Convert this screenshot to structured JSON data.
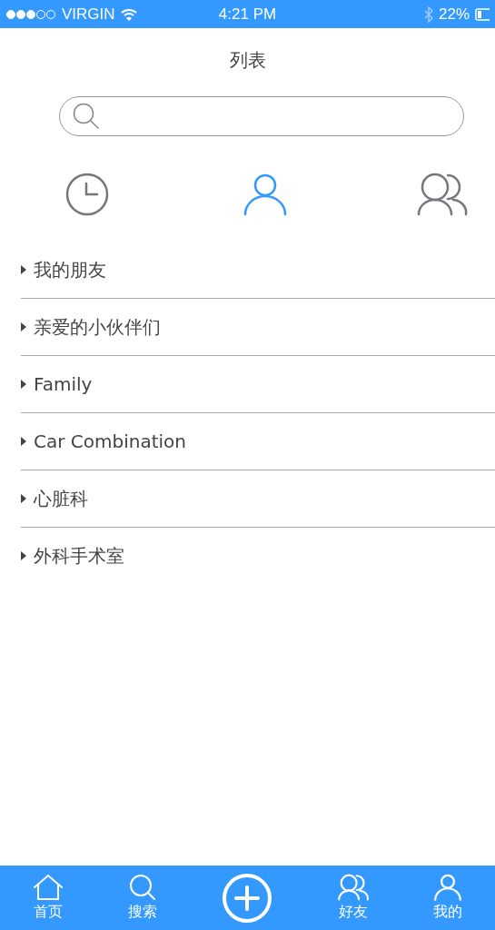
{
  "status_bar": {
    "carrier": "VIRGIN",
    "time": "4:21 PM",
    "battery": "22%"
  },
  "title": "列表",
  "segments": [
    {
      "kind": "recent",
      "selected": false
    },
    {
      "kind": "contact",
      "selected": true
    },
    {
      "kind": "group",
      "selected": false
    }
  ],
  "groups": [
    {
      "label": "我的朋友",
      "expanded": false
    },
    {
      "label": "亲爱的小伙伴们",
      "expanded": false
    },
    {
      "label": "Family",
      "expanded": false
    },
    {
      "label": "Car Combination",
      "expanded": false
    },
    {
      "label": "心脏科",
      "expanded": false
    },
    {
      "label": "外科手术室",
      "expanded": false
    }
  ],
  "tab_bar": [
    {
      "kind": "home",
      "label": "首页"
    },
    {
      "kind": "search",
      "label": "搜索"
    },
    {
      "kind": "add"
    },
    {
      "kind": "friends",
      "label": "好友"
    },
    {
      "kind": "me",
      "label": "我的"
    }
  ]
}
